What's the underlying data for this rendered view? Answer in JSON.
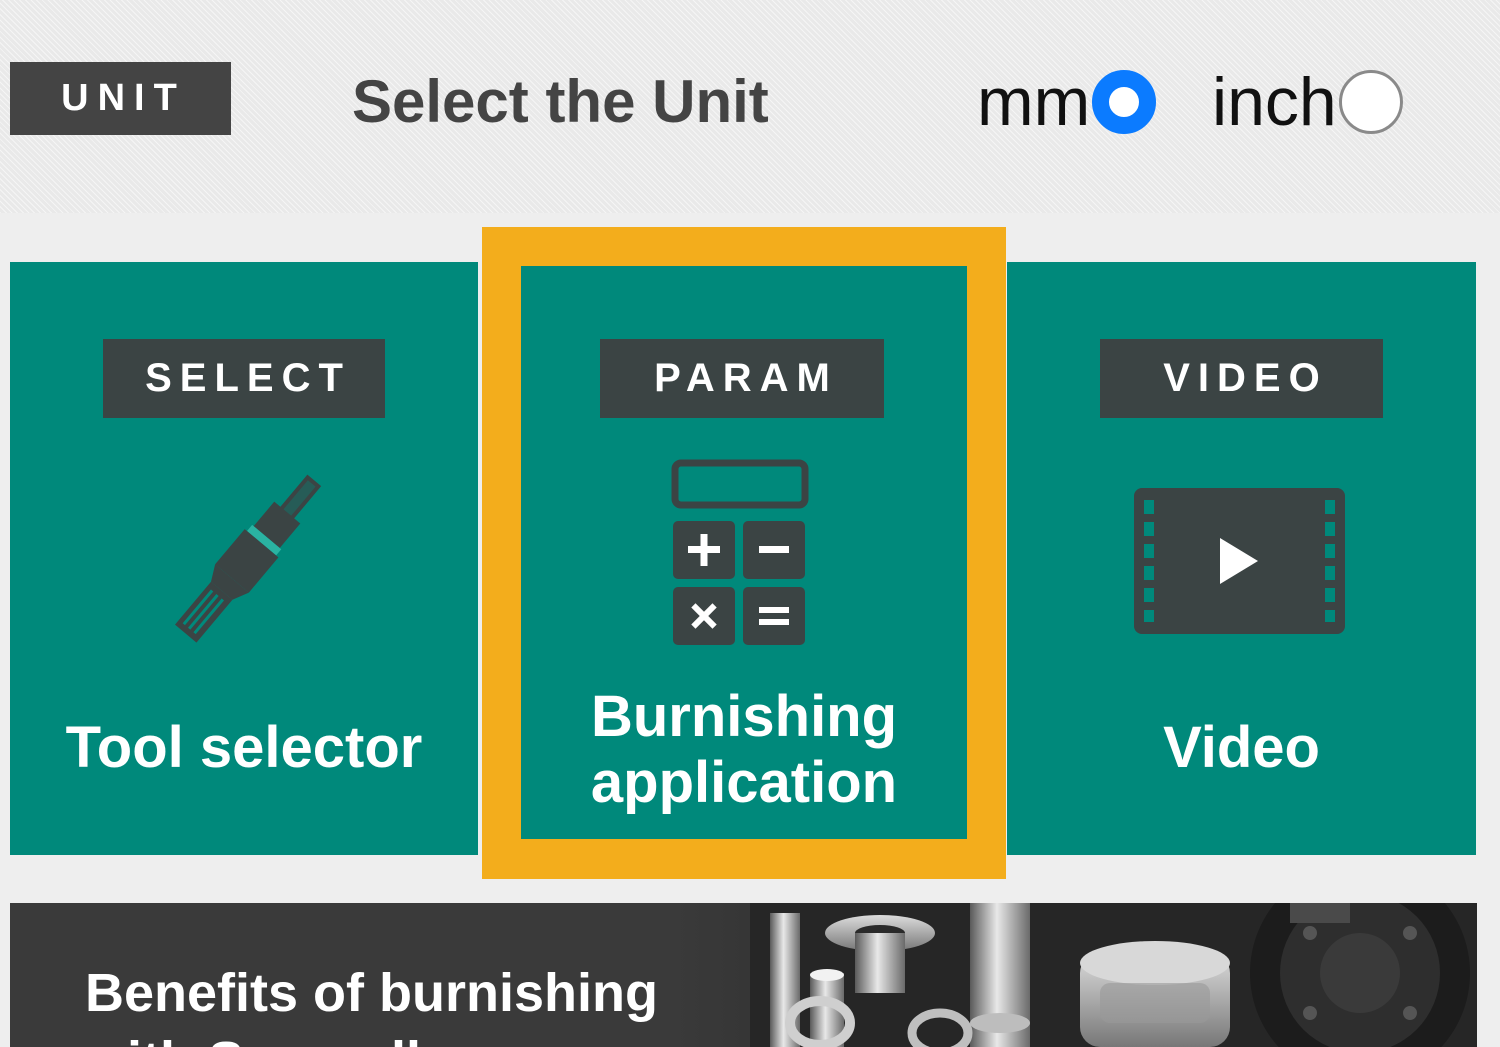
{
  "unit": {
    "badge": "UNIT",
    "title": "Select the Unit",
    "options": [
      {
        "label": "mm",
        "selected": true
      },
      {
        "label": "inch",
        "selected": false
      }
    ]
  },
  "cards": [
    {
      "badge": "SELECT",
      "label": "Tool selector",
      "icon": "roller-burnishing-tool-icon"
    },
    {
      "badge": "PARAM",
      "label": "Burnishing\napplication",
      "icon": "calculator-icon",
      "highlighted": true
    },
    {
      "badge": "VIDEO",
      "label": "Video",
      "icon": "video-play-icon"
    }
  ],
  "banner": {
    "title": "Benefits of burnishing\nwith Sugarall"
  },
  "colors": {
    "card_bg": "#00897b",
    "highlight_border": "#f3ad1c",
    "badge_bg": "#3b4444",
    "radio_selected": "#0b7bff"
  }
}
